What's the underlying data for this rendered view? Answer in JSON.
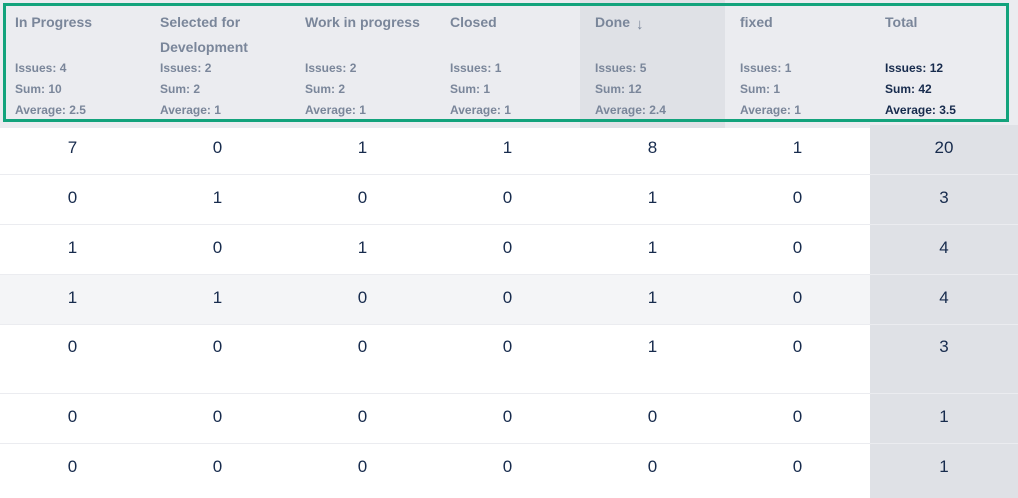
{
  "columns": [
    {
      "title": "In Progress",
      "issues": "Issues: 4",
      "sum": "Sum: 10",
      "average": "Average: 2.5"
    },
    {
      "title": "Selected for Development",
      "issues": "Issues: 2",
      "sum": "Sum: 2",
      "average": "Average: 1"
    },
    {
      "title": "Work in progress",
      "issues": "Issues: 2",
      "sum": "Sum: 2",
      "average": "Average: 1"
    },
    {
      "title": "Closed",
      "issues": "Issues: 1",
      "sum": "Sum: 1",
      "average": "Average: 1"
    },
    {
      "title": "Done",
      "issues": "Issues: 5",
      "sum": "Sum: 12",
      "average": "Average: 2.4",
      "sort_icon": "arrow-down-icon"
    },
    {
      "title": "fixed",
      "issues": "Issues: 1",
      "sum": "Sum: 1",
      "average": "Average: 1"
    },
    {
      "title": "Total",
      "issues": "Issues: 12",
      "sum": "Sum: 42",
      "average": "Average: 3.5"
    }
  ],
  "rows": [
    [
      "7",
      "0",
      "1",
      "1",
      "8",
      "1",
      "20"
    ],
    [
      "0",
      "1",
      "0",
      "0",
      "1",
      "0",
      "3"
    ],
    [
      "1",
      "0",
      "1",
      "0",
      "1",
      "0",
      "4"
    ],
    [
      "1",
      "1",
      "0",
      "0",
      "1",
      "0",
      "4"
    ],
    [
      "0",
      "0",
      "0",
      "0",
      "1",
      "0",
      "3"
    ],
    [
      "0",
      "0",
      "0",
      "0",
      "0",
      "0",
      "1"
    ],
    [
      "0",
      "0",
      "0",
      "0",
      "0",
      "0",
      "1"
    ]
  ],
  "colors": {
    "highlight_border": "#13a37c",
    "header_bg": "#ebecf0",
    "sorted_bg": "#dfe1e6",
    "total_bg": "#dfe1e6"
  }
}
